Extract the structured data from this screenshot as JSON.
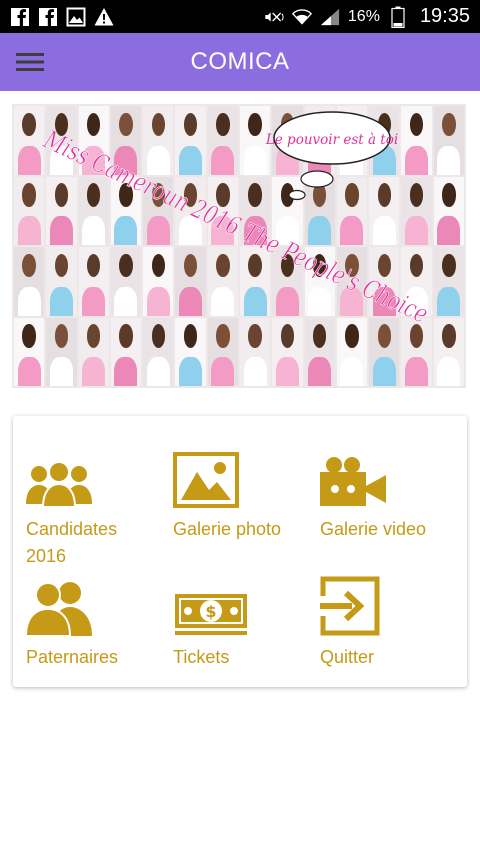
{
  "status_bar": {
    "icons_left": [
      "facebook-icon",
      "facebook-icon",
      "gallery-icon",
      "warning-icon"
    ],
    "battery_percent": "16%",
    "time": "19:35"
  },
  "app_bar": {
    "title": "COMICA",
    "menu_icon": "hamburger-icon"
  },
  "banner": {
    "title_text": "Miss Cameroun 2016 The People's Choice",
    "speech_bubble": "Le pouvoir est à toi"
  },
  "menu": {
    "items": [
      {
        "label": "Candidates\n2016",
        "icon": "people-group-icon"
      },
      {
        "label": "Galerie photo",
        "icon": "image-icon"
      },
      {
        "label": "Galerie video",
        "icon": "video-camera-icon"
      },
      {
        "label": "Paternaires",
        "icon": "people-pair-icon"
      },
      {
        "label": "Tickets",
        "icon": "money-ticket-icon"
      },
      {
        "label": "Quitter",
        "icon": "exit-icon"
      }
    ]
  },
  "colors": {
    "app_bar": "#8c6de0",
    "accent": "#c59a16",
    "banner_text": "#e0319a"
  }
}
